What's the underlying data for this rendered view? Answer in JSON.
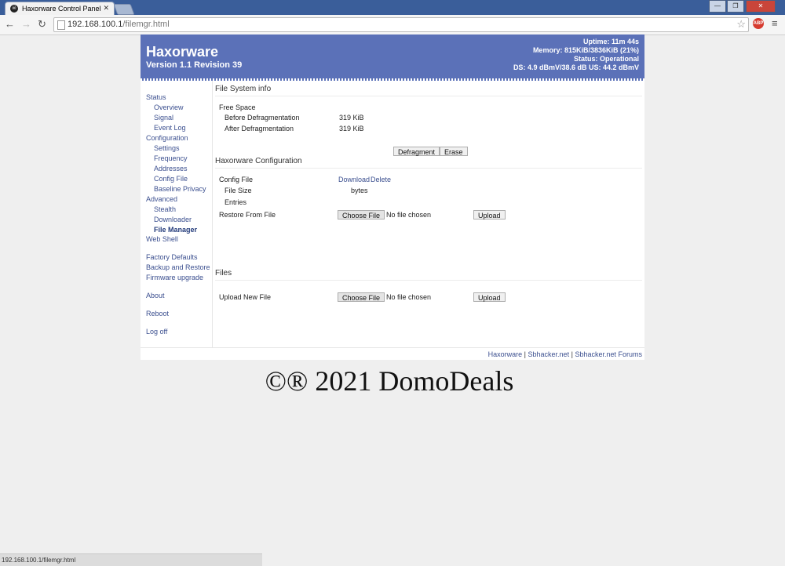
{
  "browser": {
    "tab_title": "Haxorware Control Panel",
    "tab_close": "✕",
    "url_host": "192.168.100.1",
    "url_path": "/filemgr.html",
    "back_glyph": "←",
    "forward_glyph": "→",
    "reload_glyph": "↻",
    "star_glyph": "☆",
    "abp_label": "ABP",
    "menu_glyph": "≡",
    "minimize_glyph": "—",
    "maximize_glyph": "❐",
    "close_glyph": "✕",
    "status_url": "192.168.100.1/filemgr.html"
  },
  "header": {
    "brand": "Haxorware",
    "version": "Version 1.1 Revision 39",
    "uptime": "Uptime: 11m 44s",
    "memory": "Memory: 815KiB/3836KiB (21%)",
    "status": "Status: Operational",
    "signal": "DS: 4.9 dBmV/38.6 dB US: 44.2 dBmV",
    "bg_color": "#5b71b8"
  },
  "sidebar": {
    "status": "Status",
    "overview": "Overview",
    "signal": "Signal",
    "event_log": "Event Log",
    "configuration": "Configuration",
    "settings": "Settings",
    "frequency": "Frequency",
    "addresses": "Addresses",
    "config_file": "Config File",
    "baseline_privacy": "Baseline Privacy",
    "advanced": "Advanced",
    "stealth": "Stealth",
    "downloader": "Downloader",
    "file_manager": "File Manager",
    "web_shell": "Web Shell",
    "factory_defaults": "Factory Defaults",
    "backup_restore": "Backup and Restore",
    "firmware_upgrade": "Firmware upgrade",
    "about": "About",
    "reboot": "Reboot",
    "log_off": "Log off"
  },
  "fs_info": {
    "title": "File System info",
    "free_space": "Free Space",
    "before_label": "Before Defragmentation",
    "before_value": "319 KiB",
    "after_label": "After Defragmentation",
    "after_value": "319 KiB",
    "defragment_btn": "Defragment",
    "erase_btn": "Erase"
  },
  "hx_config": {
    "title": "Haxorware Configuration",
    "config_file": "Config File",
    "download": "Download",
    "delete": "Delete",
    "file_size": "File Size",
    "bytes": "bytes",
    "entries": "Entries",
    "restore_label": "Restore From File",
    "choose_file": "Choose File",
    "no_file": "No file chosen",
    "upload": "Upload"
  },
  "files": {
    "title": "Files",
    "upload_new": "Upload New File",
    "choose_file": "Choose File",
    "no_file": "No file chosen",
    "upload": "Upload"
  },
  "footer": {
    "haxorware": "Haxorware",
    "sbhacker": "Sbhacker.net",
    "forums": "Sbhacker.net Forums",
    "separator": "|"
  },
  "watermark": "©® 2021 DomoDeals"
}
